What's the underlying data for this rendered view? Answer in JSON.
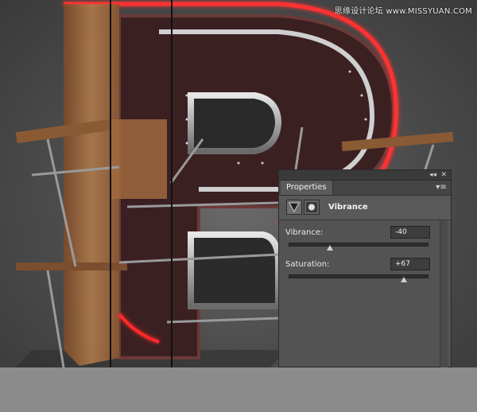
{
  "watermark": "思缘设计论坛 www.MISSYUAN.COM",
  "panel": {
    "tab_label": "Properties",
    "collapse_glyph": "◂◂",
    "close_glyph": "✕",
    "menu_glyph": "▾≡",
    "adjustment_title": "Vibrance",
    "vibrance": {
      "label": "Vibrance:",
      "value": "-40",
      "fraction": 0.3
    },
    "saturation": {
      "label": "Saturation:",
      "value": "+67",
      "fraction": 0.835
    }
  },
  "colors": {
    "neon": "#ff2a2a",
    "wood": "#a06a3e",
    "panel_bg": "#535353"
  }
}
